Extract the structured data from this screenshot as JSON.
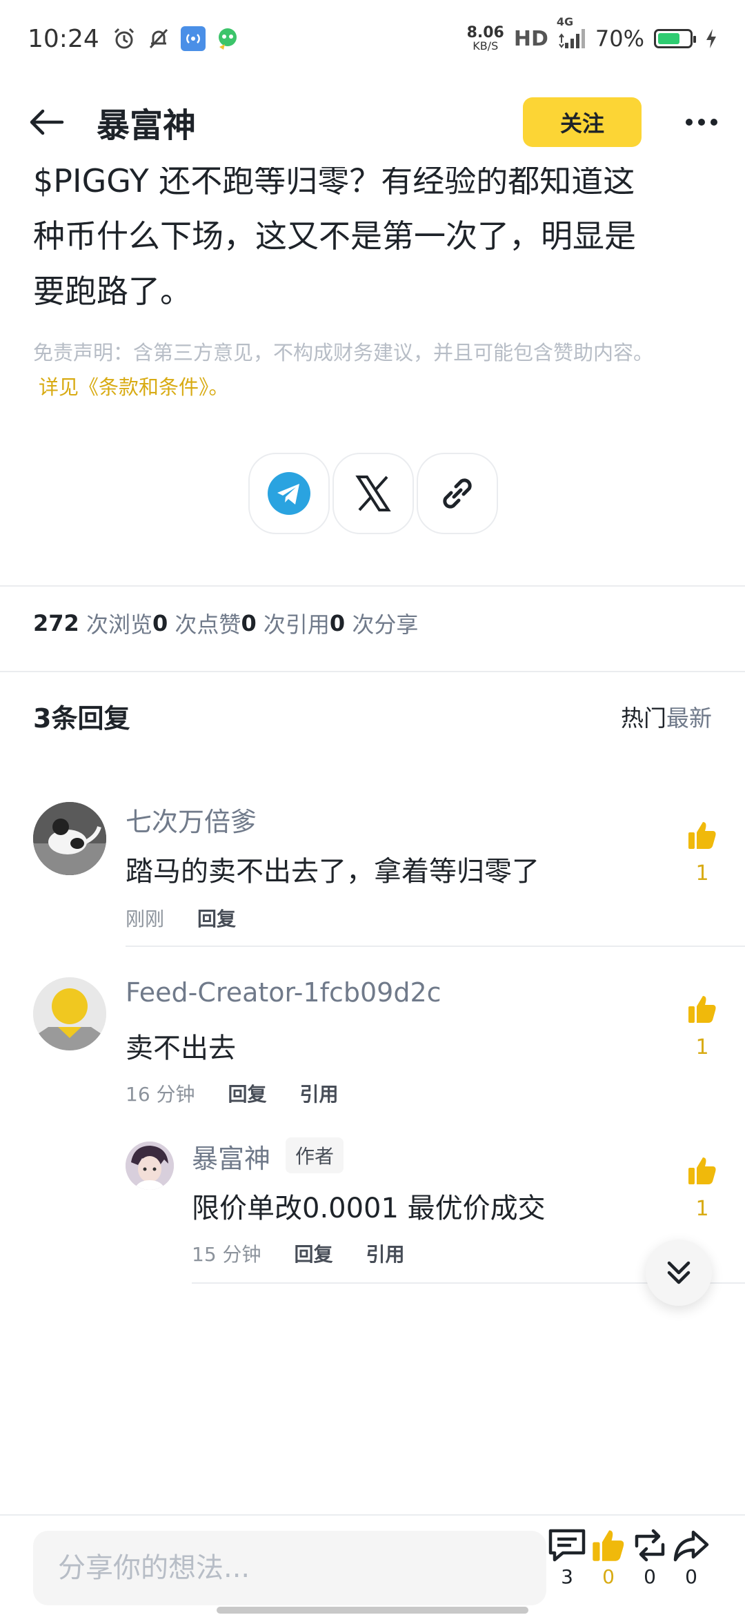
{
  "status_bar": {
    "time": "10:24",
    "net_speed_value": "8.06",
    "net_speed_unit": "KB/S",
    "hd": "HD",
    "network": "4G",
    "battery_pct": "70%",
    "battery_level": 0.7,
    "icons": [
      "alarm-icon",
      "mute-icon",
      "hotspot-icon",
      "app-notification-icon",
      "signal-icon",
      "charging-icon"
    ]
  },
  "header": {
    "title": "暴富神",
    "follow_label": "关注",
    "accent_color": "#fcd535"
  },
  "post": {
    "text_line1": "$PIGGY 还不跑等归零？有经验的都知道这",
    "text_line2": "种币什么下场，这又不是第一次了，明显是",
    "text_line3": "要跑路了。",
    "disclaimer": "免责声明：含第三方意见，不构成财务建议，并且可能包含赞助内容。",
    "disclaimer_link": "详见《条款和条件》。"
  },
  "share": {
    "buttons": [
      "telegram-icon",
      "x-icon",
      "link-icon"
    ]
  },
  "stats": {
    "views_count": "272",
    "views_label": "次浏览",
    "likes_count": "0",
    "likes_label": "次点赞",
    "quotes_count": "0",
    "quotes_label": "次引用",
    "shares_count": "0",
    "shares_label": "次分享"
  },
  "replies": {
    "count_label": "3条回复",
    "sort_hot": "热门",
    "sort_new": "最新",
    "comments": [
      {
        "author": "七次万倍爹",
        "text": "踏马的卖不出去了，拿着等归零了",
        "time": "刚刚",
        "reply_label": "回复",
        "likes": "1"
      },
      {
        "author": "Feed-Creator-1fcb09d2c",
        "text": "卖不出去",
        "time": "16 分钟",
        "reply_label": "回复",
        "quote_label": "引用",
        "likes": "1"
      },
      {
        "author": "暴富神",
        "badge": "作者",
        "text": "限价单改0.0001 最优价成交",
        "time": "15 分钟",
        "reply_label": "回复",
        "quote_label": "引用",
        "likes": "1"
      }
    ]
  },
  "bottom_bar": {
    "input_placeholder": "分享你的想法...",
    "comments_count": "3",
    "likes_count": "0",
    "reposts_count": "0",
    "shares_count": "0"
  }
}
